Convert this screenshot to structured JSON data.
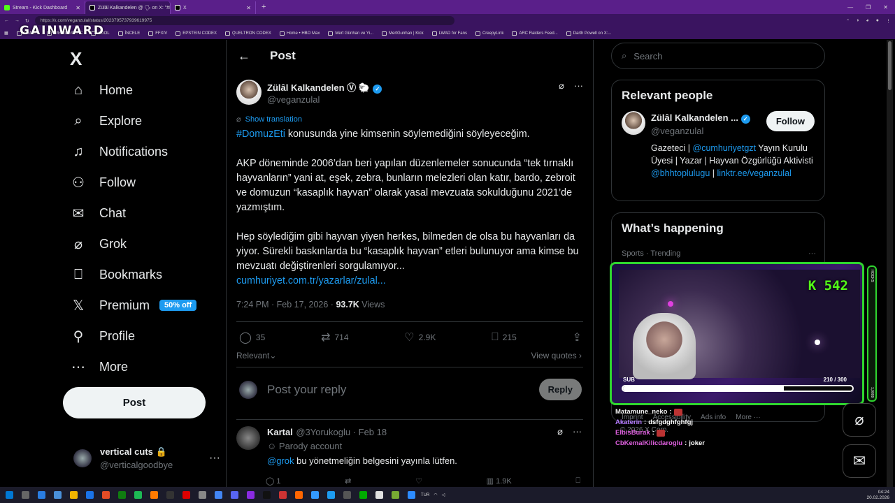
{
  "browser": {
    "tabs": [
      {
        "title": "Stream - Kick Dashboard",
        "color": "#53fc18"
      },
      {
        "title": "Zülâl Kalkandelen @ 🗣 on X: \"#D...",
        "color": "#000000"
      },
      {
        "title": "X",
        "color": "#000000"
      }
    ],
    "new_tab": "+",
    "url": "https://x.com/veganzulal/status/2023795737939619975",
    "bookmarks": [
      "GAMES",
      "WEIRD MUSIC",
      "TOOL",
      "İNCELE",
      "FFXIV",
      "EPSTEIN CODEX",
      "QUELTRON CODEX",
      "Home • HBO Max",
      "Mert Günhan ve Yi...",
      "MertGunhan | Kick",
      "LWAD for Fans",
      "CreepyLink",
      "ARC Raiders Feed...",
      "Darth Powell on X:..."
    ],
    "overlay_logo": "GAINWARD"
  },
  "nav": {
    "logo": "X",
    "items": [
      {
        "label": "Home",
        "icon": "home-icon"
      },
      {
        "label": "Explore",
        "icon": "search-icon"
      },
      {
        "label": "Notifications",
        "icon": "bell-icon"
      },
      {
        "label": "Follow",
        "icon": "follow-icon"
      },
      {
        "label": "Chat",
        "icon": "mail-icon"
      },
      {
        "label": "Grok",
        "icon": "grok-icon"
      },
      {
        "label": "Bookmarks",
        "icon": "bookmark-icon"
      },
      {
        "label": "Premium",
        "icon": "x-icon"
      },
      {
        "label": "Profile",
        "icon": "person-icon"
      },
      {
        "label": "More",
        "icon": "more-icon"
      }
    ],
    "premium_badge": "50% off",
    "post_button": "Post",
    "account": {
      "name": "vertical cuts 🔒",
      "handle": "@verticalgoodbye",
      "more": "···"
    }
  },
  "post": {
    "header_title": "Post",
    "author_name": "Zülâl Kalkandelen Ⓥ 🐑",
    "author_handle": "@veganzulal",
    "show_translation": "Show translation",
    "hashtag": "#DomuzEti",
    "para1_rest": " konusunda yine kimsenin söylemediğini söyleyeceğim.",
    "para2": "AKP döneminde 2006’dan beri yapılan düzenlemeler sonucunda “tek tırnaklı hayvanların” yani at, eşek, zebra, bunların melezleri olan katır, bardo, zebroit ve domuzun “kasaplık hayvan” olarak yasal mevzuata sokulduğunu 2021’de yazmıştım.",
    "para3": "Hep söylediğim gibi hayvan yiyen herkes, bilmeden de olsa bu hayvanları da yiyor. Sürekli baskınlarda bu “kasaplık hayvan” etleri bulunuyor ama kimse bu mevzuatı değiştirenleri sorgulamıyor...",
    "link": "cumhuriyet.com.tr/yazarlar/zulal...",
    "time": "7:24 PM · Feb 17, 2026 · ",
    "views_count": "93.7K",
    "views_label": " Views",
    "stats": {
      "replies": "35",
      "reposts": "714",
      "likes": "2.9K",
      "bookmarks": "215"
    },
    "relevant": "Relevant",
    "view_quotes": "View quotes",
    "reply_placeholder": "Post your reply",
    "reply_button": "Reply"
  },
  "comment": {
    "name": "Kartal",
    "handle": "@3Yorukoglu · Feb 18",
    "parody": "Parody account",
    "mention": "@grok",
    "text": " bu yönetmeliğin belgesini yayınla lütfen.",
    "replies": "1",
    "views": "1.9K"
  },
  "right": {
    "search_placeholder": "Search",
    "relevant_title": "Relevant people",
    "person_name": "Zülâl Kalkandelen ...",
    "person_handle": "@veganzulal",
    "follow_button": "Follow",
    "bio_1": "Gazeteci | ",
    "bio_mention1": "@cumhuriyetgzt",
    "bio_2": " Yayın Kurulu Üyesi | Yazar | Hayvan Özgürlüğü Aktivisti ",
    "bio_mention2": "@bhhtoplulugu",
    "bio_3": " | ",
    "bio_link": "linktr.ee/veganzulal",
    "happening_title": "What’s happening",
    "trend_meta": "Sports · Trending",
    "footer": [
      "Imprint",
      "Accessibility",
      "Ads info",
      "More ···"
    ],
    "copyright": "© 2026 X Corp."
  },
  "stream": {
    "kick_count": "542",
    "sub_label": "SUB",
    "sub_count": "210 / 300",
    "sub_progress": 0.7,
    "side_labels": [
      "HOCKS",
      "1,0009"
    ],
    "chat": [
      {
        "user": "Matamune_neko",
        "sep": " :",
        "msg": "",
        "emoji": true
      },
      {
        "user": "Akaterin",
        "sep": " :",
        "msg": " dsfgdghfghfgj",
        "emoji": false
      },
      {
        "user": "ElbisBurak",
        "sep": " :",
        "msg": "",
        "emoji": true
      },
      {
        "user": "CbKemalKilicdaroglu",
        "sep": " :",
        "msg": " joker",
        "emoji": false
      }
    ]
  },
  "taskbar": {
    "lang": "TUR",
    "time": "04:24",
    "date": "20.02.2026"
  }
}
